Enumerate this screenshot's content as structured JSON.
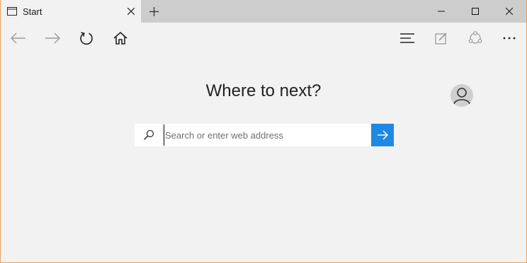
{
  "tab": {
    "title": "Start",
    "icon": "window-icon"
  },
  "nav": {
    "back_icon": "back-arrow-icon",
    "forward_icon": "forward-arrow-icon",
    "refresh_icon": "refresh-icon",
    "home_icon": "home-icon",
    "hub_icon": "hub-icon",
    "note_icon": "web-note-icon",
    "share_icon": "share-icon",
    "more_icon": "more-icon"
  },
  "main": {
    "heading": "Where to next?",
    "search_placeholder": "Search or enter web address"
  },
  "colors": {
    "accent": "#1e88e5",
    "titlebar": "#cdcdcd",
    "background": "#f2f2f2",
    "window_border": "#e8a25f"
  }
}
